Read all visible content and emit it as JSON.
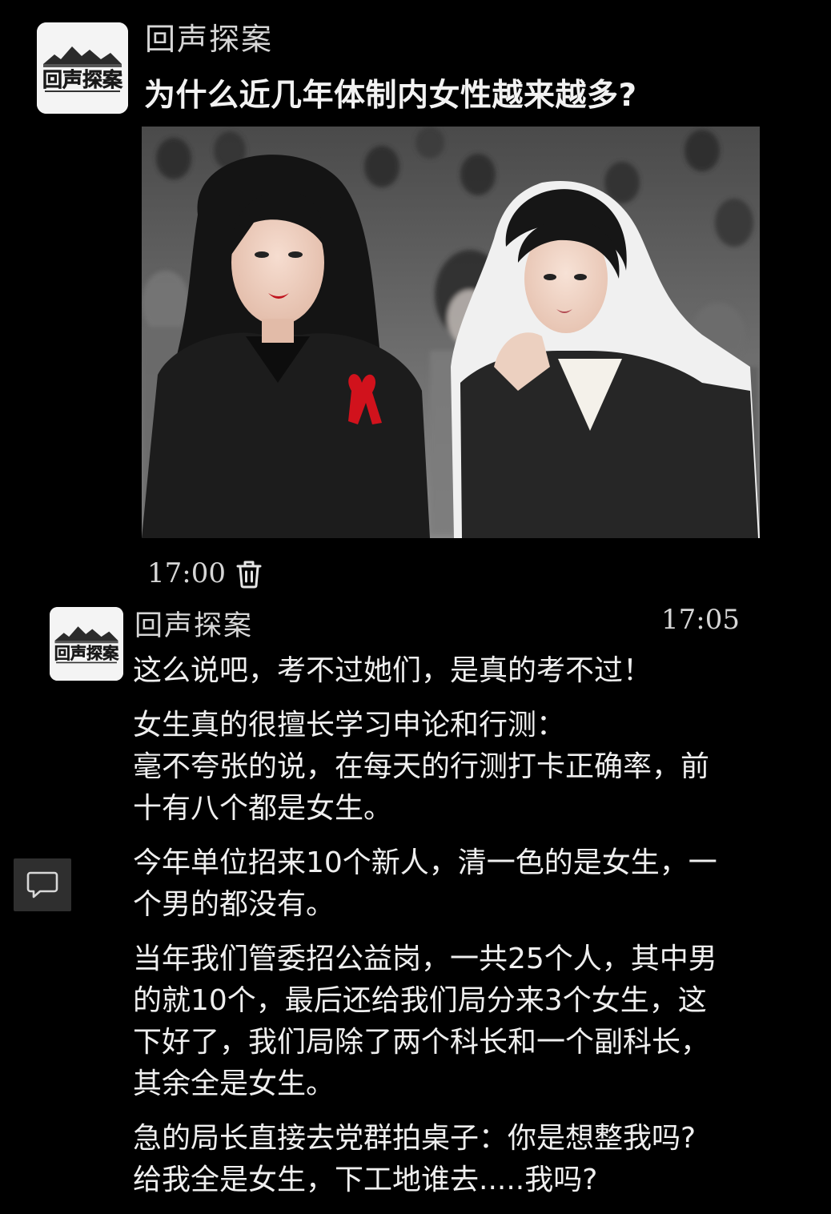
{
  "post": {
    "author": "回声探案",
    "title": "为什么近几年体制内女性越来越多?",
    "time": "17:00"
  },
  "reply": {
    "author": "回声探案",
    "time": "17:05",
    "paragraphs": [
      [
        "这么说吧，考不过她们，是真的考不过！"
      ],
      [
        "女生真的很擅长学习申论和行测：",
        "毫不夸张的说，在每天的行测打卡正确率，前",
        "十有八个都是女生。"
      ],
      [
        "今年单位招来10个新人，清一色的是女生，一",
        "个男的都没有。"
      ],
      [
        "当年我们管委招公益岗，一共25个人，其中男",
        "的就10个，最后还给我们局分来3个女生，这",
        "下好了，我们局除了两个科长和一个副科长，",
        "其余全是女生。"
      ],
      [
        "急的局长直接去党群拍桌子：你是想整我吗?",
        "给我全是女生，下工地谁去.....我吗?"
      ]
    ]
  },
  "icons": {
    "avatar_logo": "回声探案",
    "delete": "trash-icon",
    "comment": "comment-bubble-icon"
  },
  "colors": {
    "background": "#000000",
    "text": "#efefef",
    "muted_text": "#d6d6d6",
    "side_button": "#2f2f2f"
  }
}
